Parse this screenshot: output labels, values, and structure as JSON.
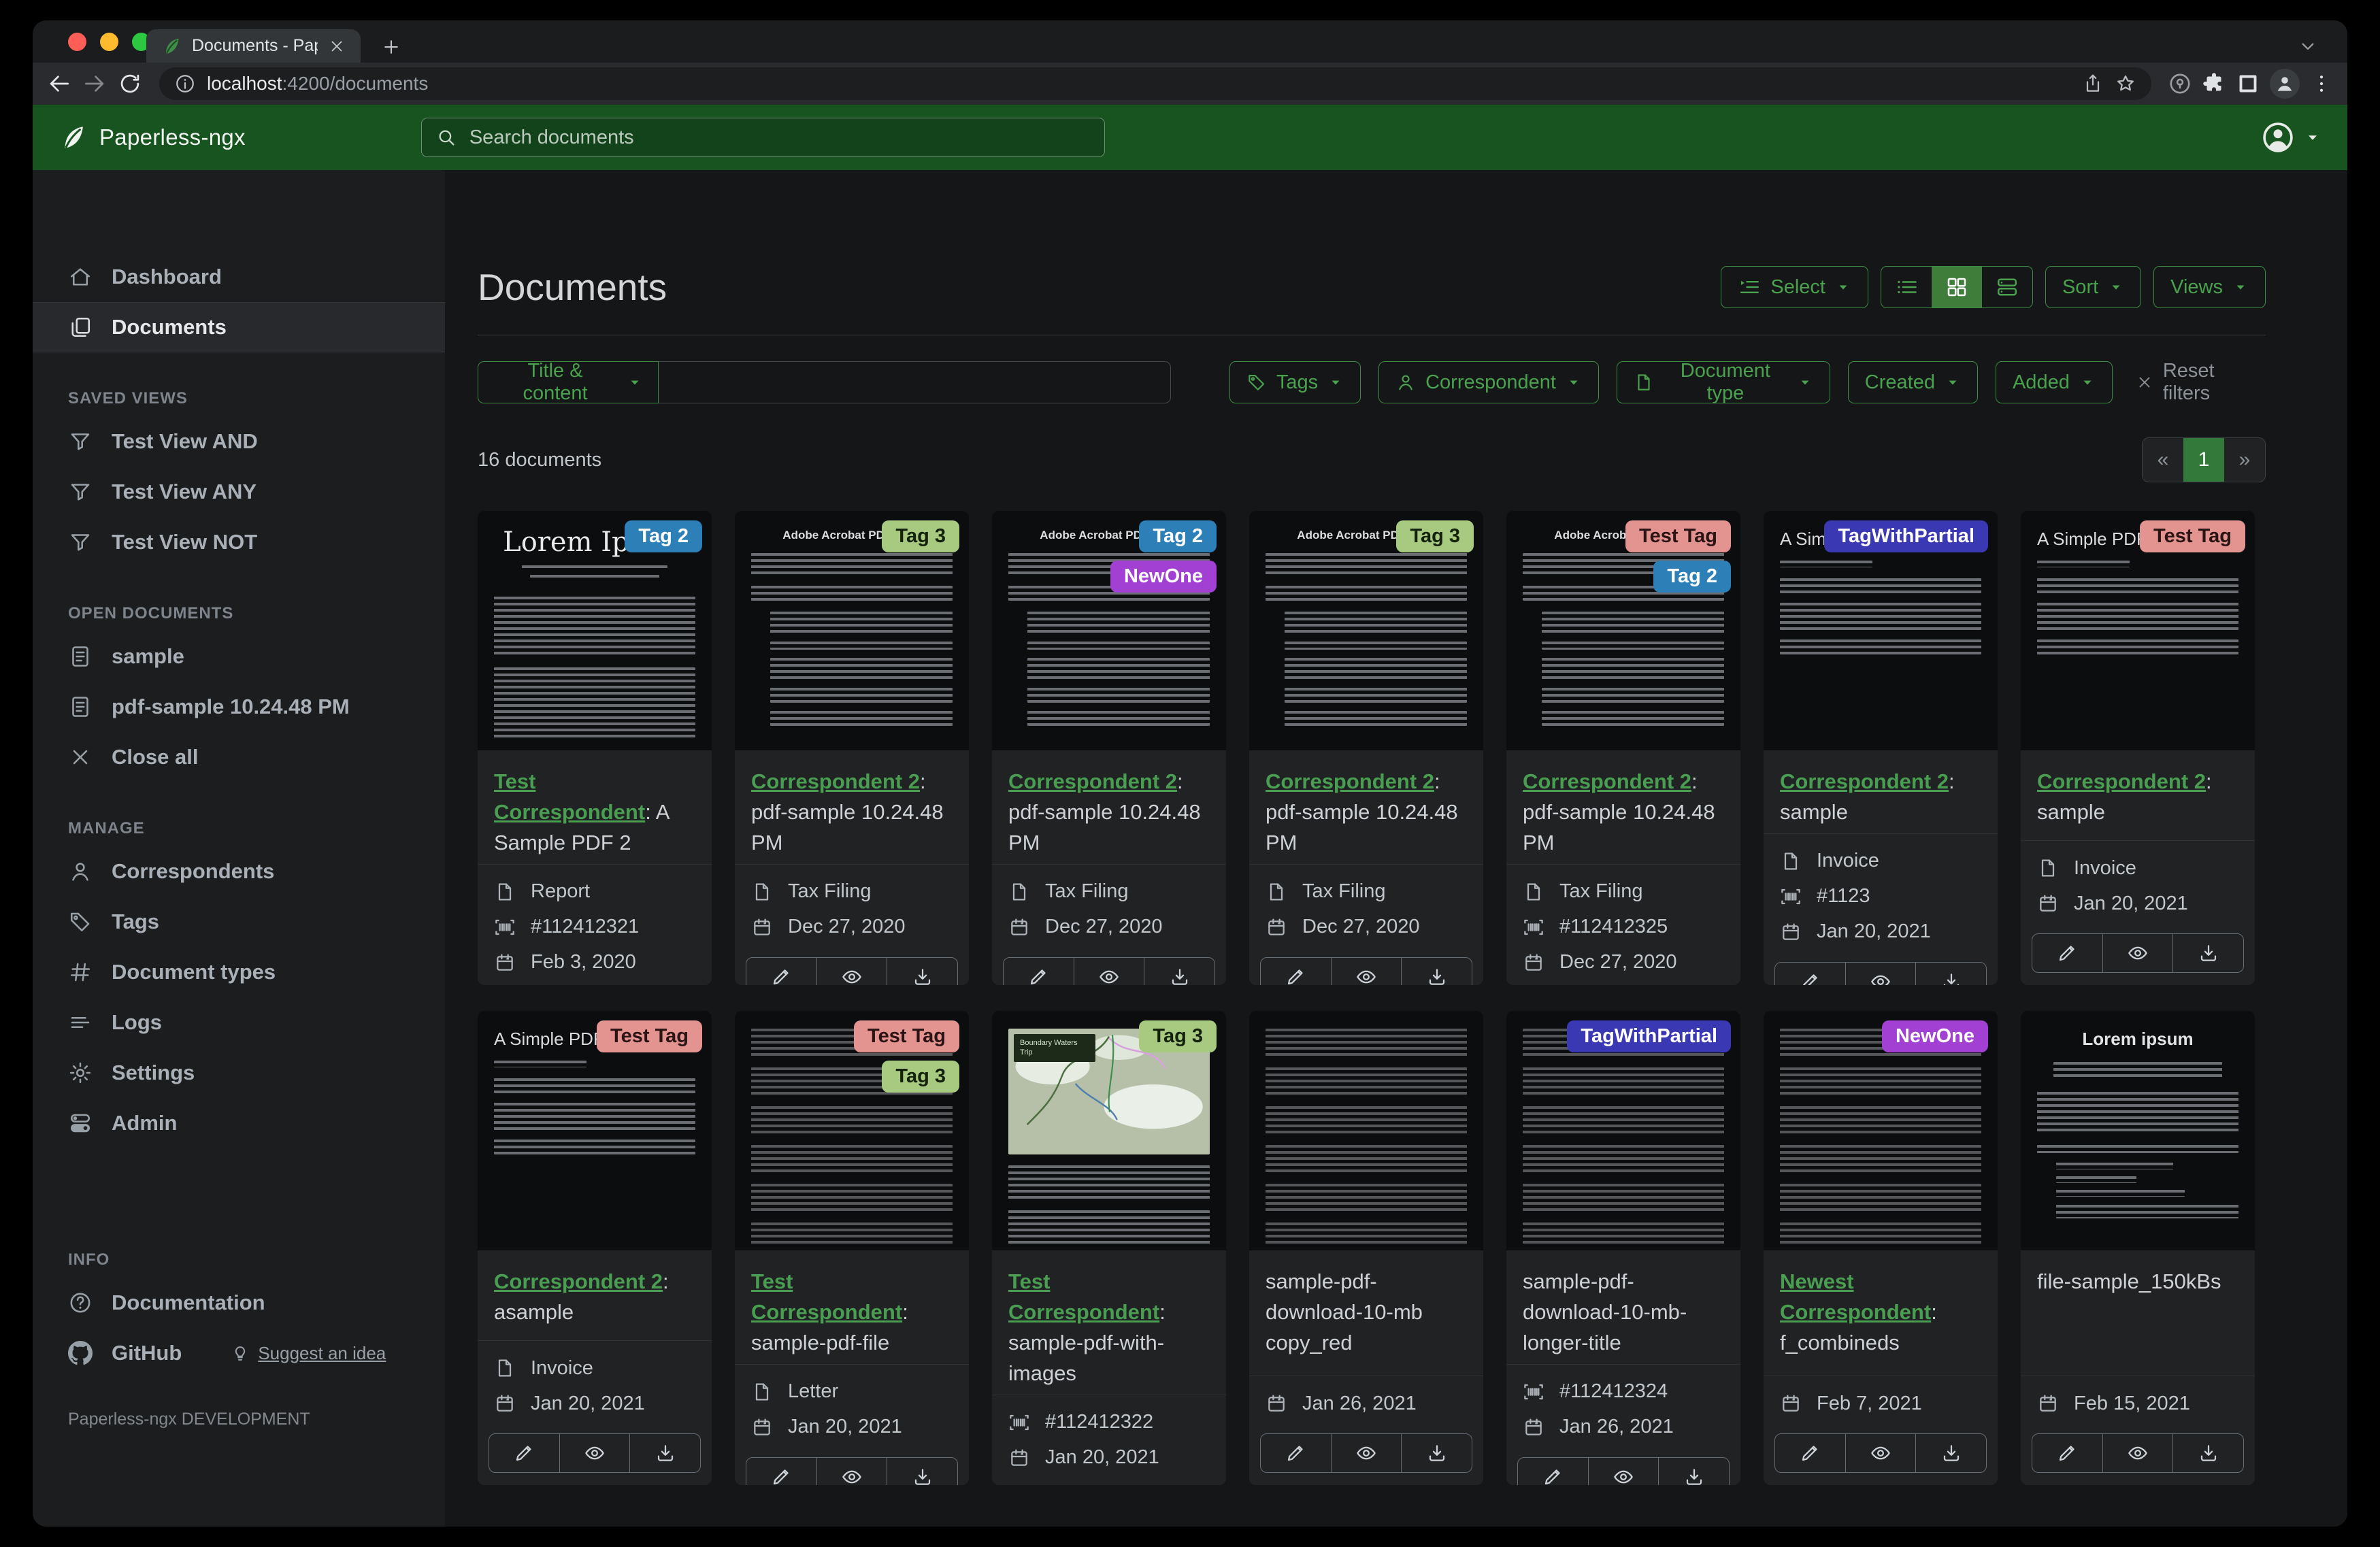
{
  "browser": {
    "tab_title": "Documents - Paperless-ngx",
    "url": {
      "host": "localhost",
      "rest": ":4200/documents"
    }
  },
  "app_header": {
    "app_name": "Paperless-ngx",
    "search_placeholder": "Search documents"
  },
  "sidebar": {
    "primary": [
      {
        "label": "Dashboard",
        "icon": "home",
        "active": false
      },
      {
        "label": "Documents",
        "icon": "docs",
        "active": true
      }
    ],
    "sections": [
      {
        "label": "SAVED VIEWS",
        "items": [
          {
            "label": "Test View AND",
            "icon": "funnel"
          },
          {
            "label": "Test View ANY",
            "icon": "funnel"
          },
          {
            "label": "Test View NOT",
            "icon": "funnel"
          }
        ]
      },
      {
        "label": "OPEN DOCUMENTS",
        "items": [
          {
            "label": "sample",
            "icon": "filetext"
          },
          {
            "label": "pdf-sample 10.24.48 PM",
            "icon": "filetext"
          },
          {
            "label": "Close all",
            "icon": "close"
          }
        ]
      },
      {
        "label": "MANAGE",
        "items": [
          {
            "label": "Correspondents",
            "icon": "person"
          },
          {
            "label": "Tags",
            "icon": "tag"
          },
          {
            "label": "Document types",
            "icon": "hash"
          },
          {
            "label": "Logs",
            "icon": "listlog"
          },
          {
            "label": "Settings",
            "icon": "gear"
          },
          {
            "label": "Admin",
            "icon": "toggles"
          }
        ]
      },
      {
        "label": "INFO",
        "items": [
          {
            "label": "Documentation",
            "icon": "question"
          },
          {
            "label": "GitHub",
            "icon": "github",
            "extra": {
              "label": "Suggest an idea",
              "icon": "bulb"
            }
          }
        ]
      }
    ],
    "footer": "Paperless-ngx DEVELOPMENT"
  },
  "page": {
    "title": "Documents",
    "select_label": "Select",
    "sort_label": "Sort",
    "views_label": "Views",
    "count_label": "16 documents",
    "pagination": {
      "prev": "«",
      "current": "1",
      "next": "»"
    }
  },
  "filters": {
    "field_selector": "Title & content",
    "search_value": "",
    "dropdowns": [
      {
        "label": "Tags",
        "icon": "tag"
      },
      {
        "label": "Correspondent",
        "icon": "person"
      },
      {
        "label": "Document type",
        "icon": "file"
      },
      {
        "label": "Created",
        "icon": null
      },
      {
        "label": "Added",
        "icon": null
      }
    ],
    "reset_label": "Reset filters"
  },
  "tag_styles": {
    "Tag 2": {
      "bg": "#2d7fb8",
      "fg": "#ffffff"
    },
    "Tag 3": {
      "bg": "#a7ca80",
      "fg": "#14220c"
    },
    "NewOne": {
      "bg": "#a240d3",
      "fg": "#ffffff"
    },
    "Test Tag": {
      "bg": "#e49490",
      "fg": "#2b1414"
    },
    "TagWithPartial": {
      "bg": "#3b38b4",
      "fg": "#ffffff"
    }
  },
  "cards": [
    {
      "tags": [
        "Tag 2"
      ],
      "correspondent": "Test Correspondent",
      "title": "A Sample PDF 2",
      "doc_type": "Report",
      "asn": "#112412321",
      "date": "Feb 3, 2020",
      "thumb": {
        "kind": "serif",
        "heading": "Lorem Ipsum"
      }
    },
    {
      "tags": [
        "Tag 3"
      ],
      "correspondent": "Correspondent 2",
      "title": "pdf-sample 10.24.48 PM",
      "doc_type": "Tax Filing",
      "asn": null,
      "date": "Dec 27, 2020",
      "thumb": {
        "kind": "acrobat",
        "heading": "Adobe Acrobat PDF Files"
      }
    },
    {
      "tags": [
        "Tag 2",
        "NewOne"
      ],
      "correspondent": "Correspondent 2",
      "title": "pdf-sample 10.24.48 PM",
      "doc_type": "Tax Filing",
      "asn": null,
      "date": "Dec 27, 2020",
      "thumb": {
        "kind": "acrobat",
        "heading": "Adobe Acrobat PDF Files"
      }
    },
    {
      "tags": [
        "Tag 3"
      ],
      "correspondent": "Correspondent 2",
      "title": "pdf-sample 10.24.48 PM",
      "doc_type": "Tax Filing",
      "asn": null,
      "date": "Dec 27, 2020",
      "thumb": {
        "kind": "acrobat",
        "heading": "Adobe Acrobat PDF Files"
      }
    },
    {
      "tags": [
        "Test Tag",
        "Tag 2"
      ],
      "correspondent": "Correspondent 2",
      "title": "pdf-sample 10.24.48 PM",
      "doc_type": "Tax Filing",
      "asn": "#112412325",
      "date": "Dec 27, 2020",
      "thumb": {
        "kind": "acrobat",
        "heading": "Adobe Acrobat PDF Files"
      }
    },
    {
      "tags": [
        "TagWithPartial"
      ],
      "correspondent": "Correspondent 2",
      "title": "sample",
      "doc_type": "Invoice",
      "asn": "#1123",
      "date": "Jan 20, 2021",
      "thumb": {
        "kind": "simple",
        "heading": "A Simple PDF File"
      }
    },
    {
      "tags": [
        "Test Tag"
      ],
      "correspondent": "Correspondent 2",
      "title": "sample",
      "doc_type": "Invoice",
      "asn": null,
      "date": "Jan 20, 2021",
      "thumb": {
        "kind": "simple",
        "heading": "A Simple PDF File"
      }
    },
    {
      "tags": [
        "Test Tag"
      ],
      "correspondent": "Correspondent 2",
      "title": "asample",
      "doc_type": "Invoice",
      "asn": null,
      "date": "Jan 20, 2021",
      "thumb": {
        "kind": "simple",
        "heading": "A Simple PDF File"
      }
    },
    {
      "tags": [
        "Test Tag",
        "Tag 3"
      ],
      "correspondent": "Test Correspondent",
      "title": "sample-pdf-file",
      "doc_type": "Letter",
      "asn": null,
      "date": "Jan 20, 2021",
      "thumb": {
        "kind": "dense",
        "heading": ""
      }
    },
    {
      "tags": [
        "Tag 3"
      ],
      "correspondent": "Test Correspondent",
      "title": "sample-pdf-with-images",
      "doc_type": null,
      "asn": "#112412322",
      "date": "Jan 20, 2021",
      "thumb": {
        "kind": "map",
        "heading": "",
        "map_label": "Boundary Waters Trip"
      }
    },
    {
      "tags": [],
      "correspondent": null,
      "title": "sample-pdf-download-10-mb copy_red",
      "doc_type": null,
      "asn": null,
      "date": "Jan 26, 2021",
      "thumb": {
        "kind": "dense",
        "heading": ""
      }
    },
    {
      "tags": [
        "TagWithPartial"
      ],
      "correspondent": null,
      "title": "sample-pdf-download-10-mb-longer-title",
      "doc_type": null,
      "asn": "#112412324",
      "date": "Jan 26, 2021",
      "thumb": {
        "kind": "dense",
        "heading": ""
      }
    },
    {
      "tags": [
        "NewOne"
      ],
      "correspondent": "Newest Correspondent",
      "title": "f_combineds",
      "doc_type": null,
      "asn": null,
      "date": "Feb 7, 2021",
      "thumb": {
        "kind": "dense",
        "heading": ""
      }
    },
    {
      "tags": [],
      "correspondent": null,
      "title": "file-sample_150kBs",
      "doc_type": null,
      "asn": null,
      "date": "Feb 15, 2021",
      "thumb": {
        "kind": "sans",
        "heading": "Lorem ipsum"
      }
    }
  ]
}
